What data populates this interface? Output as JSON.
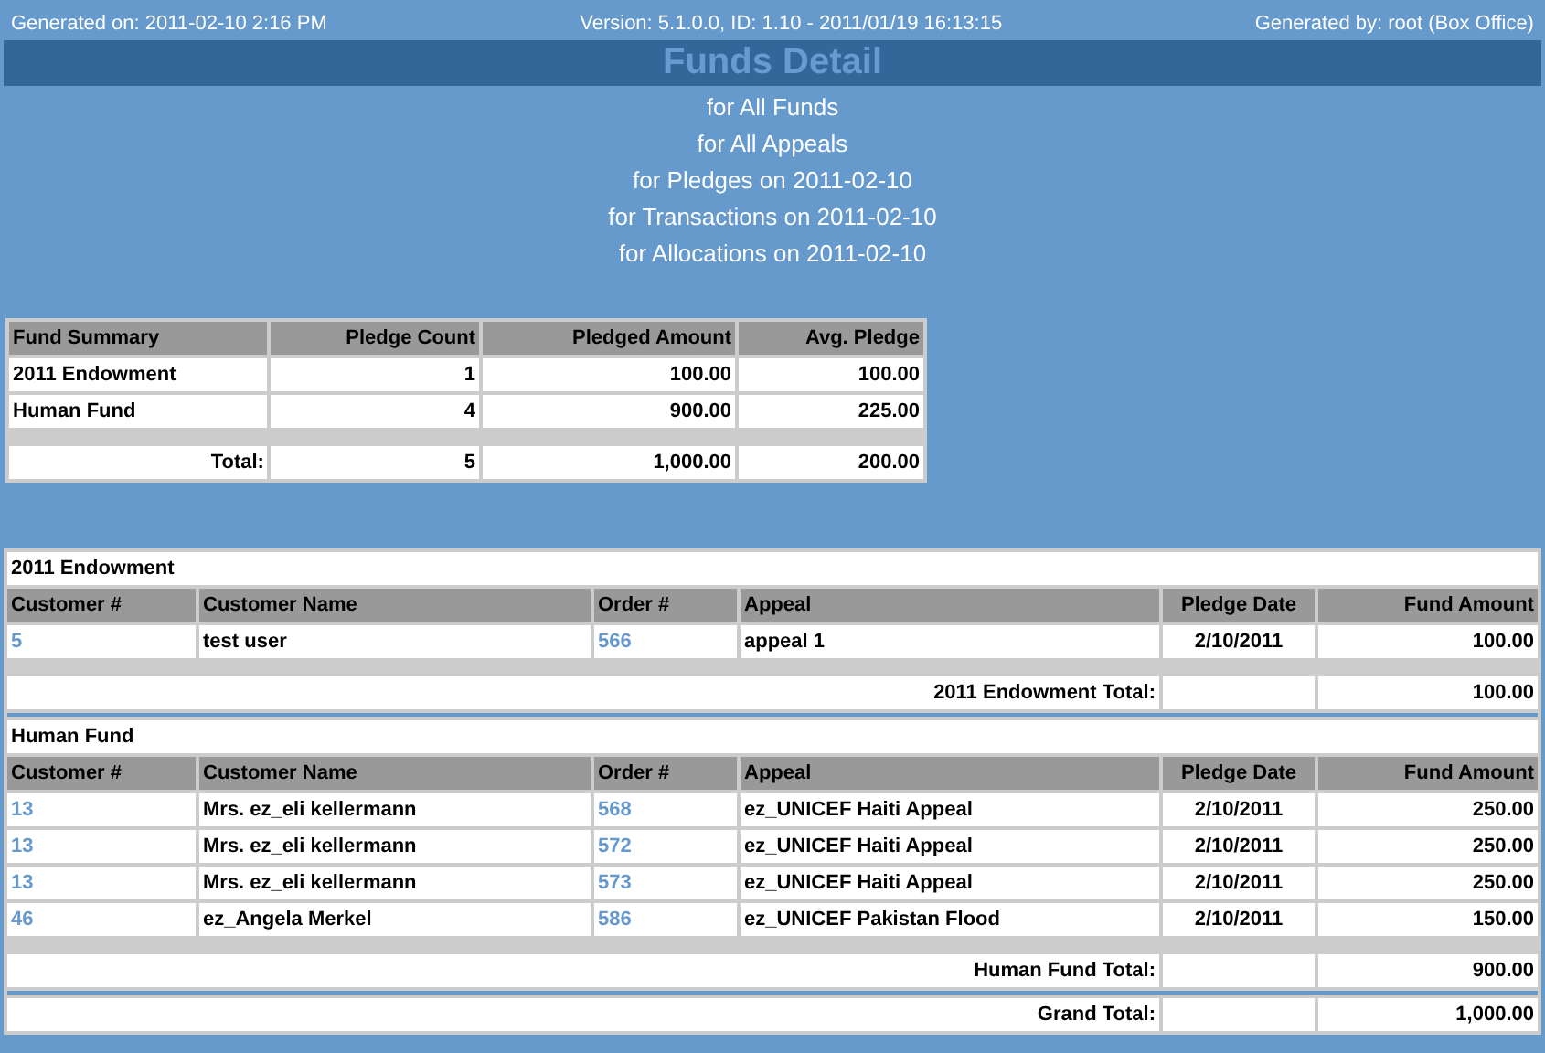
{
  "header": {
    "generated_on": "Generated on: 2011-02-10 2:16 PM",
    "version": "Version: 5.1.0.0, ID: 1.10 - 2011/01/19 16:13:15",
    "generated_by": "Generated by: root (Box Office)"
  },
  "title": "Funds Detail",
  "filters": [
    "for All Funds",
    "for All Appeals",
    "for Pledges on 2011-02-10",
    "for Transactions on 2011-02-10",
    "for Allocations on 2011-02-10"
  ],
  "summary": {
    "columns": [
      "Fund Summary",
      "Pledge Count",
      "Pledged Amount",
      "Avg. Pledge"
    ],
    "rows": [
      [
        "2011 Endowment",
        "1",
        "100.00",
        "100.00"
      ],
      [
        "Human Fund",
        "4",
        "900.00",
        "225.00"
      ]
    ],
    "total": [
      "Total:",
      "5",
      "1,000.00",
      "200.00"
    ]
  },
  "detail": {
    "groups": [
      {
        "name": "2011 Endowment",
        "columns": [
          "Customer #",
          "Customer Name",
          "Order #",
          "Appeal",
          "Pledge Date",
          "Fund Amount"
        ],
        "rows": [
          [
            "5",
            "test user",
            "566",
            "appeal 1",
            "2/10/2011",
            "100.00"
          ]
        ],
        "total_label": "2011 Endowment Total:",
        "total": "100.00"
      },
      {
        "name": "Human Fund",
        "columns": [
          "Customer #",
          "Customer Name",
          "Order #",
          "Appeal",
          "Pledge Date",
          "Fund Amount"
        ],
        "rows": [
          [
            "13",
            "Mrs. ez_eli kellermann",
            "568",
            "ez_UNICEF Haiti Appeal",
            "2/10/2011",
            "250.00"
          ],
          [
            "13",
            "Mrs. ez_eli kellermann",
            "572",
            "ez_UNICEF Haiti Appeal",
            "2/10/2011",
            "250.00"
          ],
          [
            "13",
            "Mrs. ez_eli kellermann",
            "573",
            "ez_UNICEF Haiti Appeal",
            "2/10/2011",
            "250.00"
          ],
          [
            "46",
            "ez_Angela Merkel",
            "586",
            "ez_UNICEF Pakistan Flood",
            "2/10/2011",
            "150.00"
          ]
        ],
        "total_label": "Human Fund Total:",
        "total": "900.00"
      }
    ],
    "grand_total_label": "Grand Total:",
    "grand_total": "1,000.00"
  }
}
